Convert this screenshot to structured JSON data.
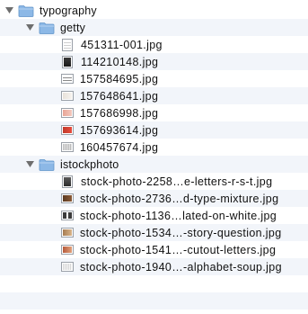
{
  "colors": {
    "row_alt": "#f2f5fa",
    "folder_blue": "#8cb8e6",
    "folder_blue_dark": "#5f93c9",
    "disclosure_gray": "#6e6e6e"
  },
  "tree": {
    "root": {
      "name": "typography",
      "icon": "folder-icon",
      "expanded": true
    },
    "folders": [
      {
        "name": "getty",
        "icon": "folder-icon",
        "expanded": true,
        "files": [
          {
            "name": "451311-001.jpg",
            "thumb": "document-thumbnail"
          },
          {
            "name": "114210148.jpg",
            "thumb": "dark-photo-thumbnail"
          },
          {
            "name": "157584695.jpg",
            "thumb": "striped-thumbnail"
          },
          {
            "name": "157648641.jpg",
            "thumb": "light-photo-thumbnail"
          },
          {
            "name": "157686998.jpg",
            "thumb": "pink-thumbnail"
          },
          {
            "name": "157693614.jpg",
            "thumb": "red-photo-thumbnail"
          },
          {
            "name": "160457674.jpg",
            "thumb": "gray-text-thumbnail"
          }
        ]
      },
      {
        "name": "istockphoto",
        "icon": "folder-icon",
        "expanded": true,
        "files": [
          {
            "name": "stock-photo-2258…e-letters-r-s-t.jpg",
            "thumb": "letters-thumbnail"
          },
          {
            "name": "stock-photo-2736…d-type-mixture.jpg",
            "thumb": "wood-type-thumbnail"
          },
          {
            "name": "stock-photo-1136…lated-on-white.jpg",
            "thumb": "isolated-thumbnail"
          },
          {
            "name": "stock-photo-1534…-story-question.jpg",
            "thumb": "story-thumbnail"
          },
          {
            "name": "stock-photo-1541…-cutout-letters.jpg",
            "thumb": "cutout-thumbnail"
          },
          {
            "name": "stock-photo-1940…-alphabet-soup.jpg",
            "thumb": "alphabet-soup-thumbnail"
          }
        ]
      }
    ]
  }
}
